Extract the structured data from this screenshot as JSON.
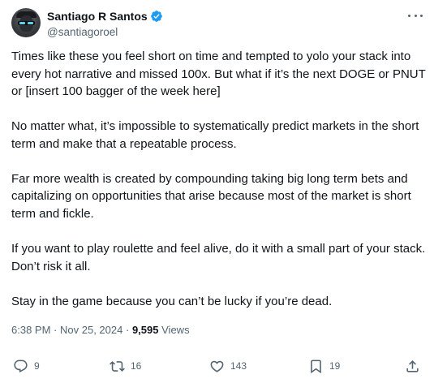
{
  "author": {
    "display_name": "Santiago R Santos",
    "handle": "@santiagoroel",
    "verified": true,
    "verified_color": "#1d9bf0"
  },
  "tweet": {
    "paragraphs": [
      "Times like these you feel short on time and tempted to yolo your stack into every hot narrative and missed 100x. But what if it’s the next DOGE or PNUT or [insert 100 bagger of the week here]",
      "No matter what, it’s impossible to systematically predict markets in the short term and make that a repeatable process.",
      "Far more wealth is created by compounding taking big long term bets and capitalizing on opportunities that arise because most of the market is short term and fickle.",
      "If you want to play roulette and feel alive, do it with a small part of your stack. Don’t risk it all.",
      "Stay in the game because you can’t be lucky if you’re dead."
    ],
    "time": "6:38 PM",
    "separator": "·",
    "date": "Nov 25, 2024",
    "views_count": "9,595",
    "views_label": "Views"
  },
  "actions": {
    "replies": "9",
    "reposts": "16",
    "likes": "143",
    "bookmarks": "19"
  },
  "icons": {
    "more": "more-options-icon",
    "reply": "reply-icon",
    "repost": "repost-icon",
    "like": "like-icon",
    "bookmark": "bookmark-icon",
    "share": "share-icon",
    "verified": "verified-badge-icon"
  },
  "colors": {
    "text_primary": "#0f1419",
    "text_secondary": "#536471",
    "accent": "#1d9bf0"
  }
}
